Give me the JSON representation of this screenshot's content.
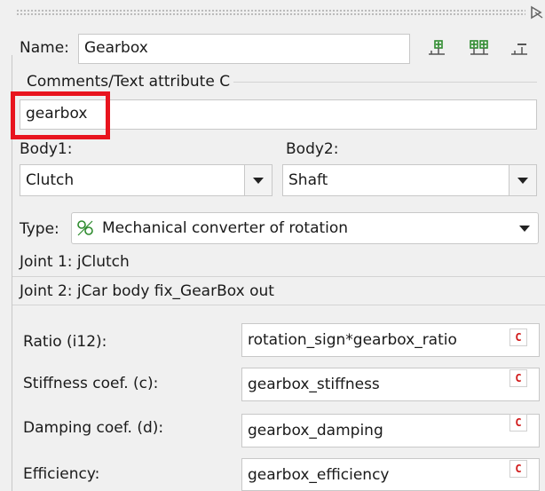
{
  "name": {
    "label": "Name:",
    "value": "Gearbox"
  },
  "comments": {
    "label": "Comments/Text attribute C",
    "value": "gearbox"
  },
  "body1": {
    "label": "Body1:",
    "value": "Clutch"
  },
  "body2": {
    "label": "Body2:",
    "value": "Shaft"
  },
  "type": {
    "label": "Type:",
    "value": "Mechanical converter of rotation"
  },
  "joints": {
    "joint1": "Joint 1: jClutch",
    "joint2": "Joint 2: jCar body fix_GearBox out"
  },
  "params": [
    {
      "label": "Ratio (i12):",
      "value": "rotation_sign*gearbox_ratio",
      "btn": "C"
    },
    {
      "label": "Stiffness coef. (c):",
      "value": "gearbox_stiffness",
      "btn": "C"
    },
    {
      "label": "Damping coef. (d):",
      "value": "gearbox_damping",
      "btn": "C"
    },
    {
      "label": "Efficiency:",
      "value": "gearbox_efficiency",
      "btn": "C"
    }
  ],
  "colors": {
    "highlight": "#e8141e",
    "icon_green": "#2e8b2e",
    "c_button": "#d01818"
  },
  "icons": [
    "add-joint-icon",
    "add-multi-joint-icon",
    "remove-joint-icon",
    "converter-type-icon",
    "panel-corner-icon",
    "dropdown-arrow-icon"
  ]
}
